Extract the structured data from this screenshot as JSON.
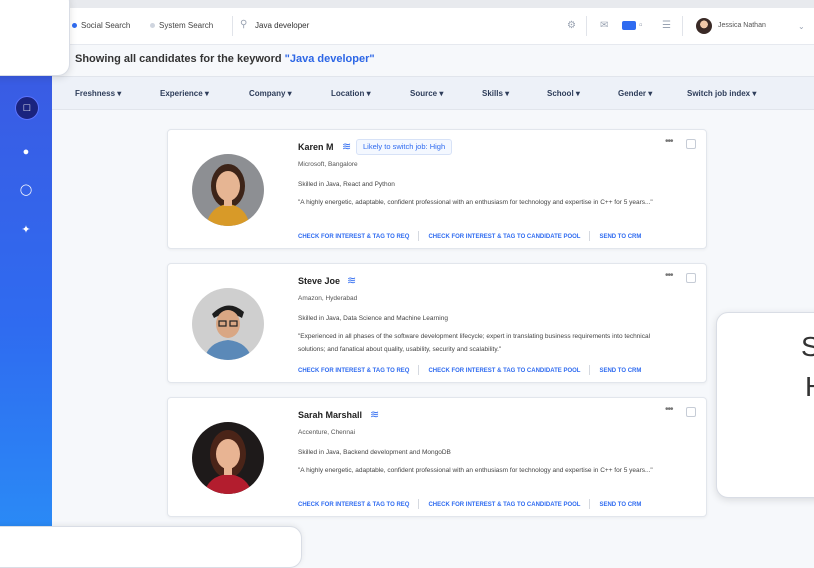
{
  "header": {
    "modes": [
      {
        "label": "Social Search",
        "active": true
      },
      {
        "label": "System Search",
        "active": false
      }
    ],
    "search_value": "Java developer",
    "user_name": "Jessica Nathan",
    "icons": [
      "search-icon",
      "gear-icon",
      "mail-icon",
      "toggle-icon",
      "chat-icon",
      "chevron-down-icon"
    ]
  },
  "results": {
    "prefix": "Showing all candidates for the keyword ",
    "keyword": "\"Java developer\""
  },
  "filters": [
    "Freshness",
    "Experience",
    "Company",
    "Location",
    "Source",
    "Skills",
    "School",
    "Gender",
    "Switch job index"
  ],
  "candidates": [
    {
      "name": "Karen M",
      "badge": "Likely to switch job: High",
      "company": "Microsoft, Bangalore",
      "skills": "Skilled in Java, React and Python",
      "summary": "\"A highly energetic, adaptable, confident professional with an enthusiasm for technology and expertise in C++ for 5 years...\""
    },
    {
      "name": "Steve Joe",
      "company": "Amazon, Hyderabad",
      "skills": "Skilled in Java, Data Science and Machine Learning",
      "summary": "\"Experienced in all phases of the software development lifecycle; expert in translating business requirements into technical solutions; and fanatical about quality, usability, security and scalability.\""
    },
    {
      "name": "Sarah Marshall",
      "company": "Accenture, Chennai",
      "skills": "Skilled in Java, Backend development and MongoDB",
      "summary": "\"A highly energetic, adaptable, confident professional with an enthusiasm for technology and expertise in C++ for 5 years...\""
    }
  ],
  "actions": {
    "interest_req": "CHECK FOR INTEREST & TAG TO REQ",
    "interest_pool": "CHECK FOR INTEREST & TAG TO CANDIDATE POOL",
    "send_crm": "SEND TO CRM"
  },
  "overlay": {
    "line1": "S",
    "line2": "H"
  },
  "colors": {
    "accent": "#2f6bf0",
    "sidebar_top": "#3d57e0",
    "sidebar_bottom": "#2a8cf6"
  }
}
